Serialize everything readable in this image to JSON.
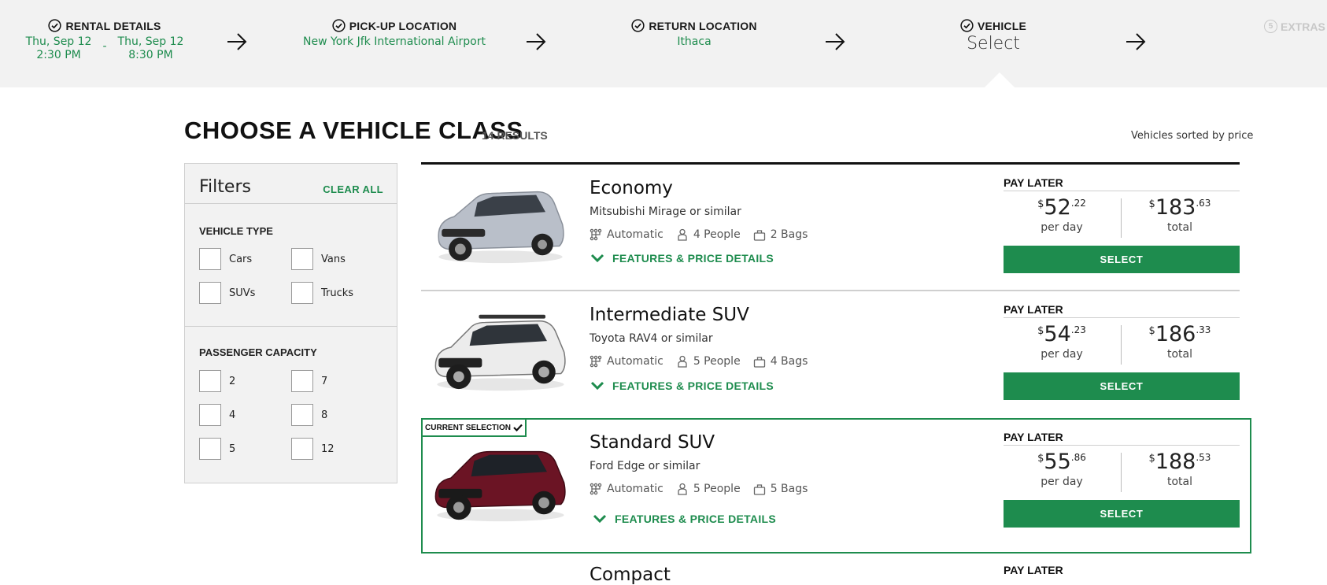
{
  "steps": {
    "rental_details": {
      "label": "RENTAL DETAILS",
      "pickup_date": "Thu, Sep 12",
      "pickup_time": "2:30 PM",
      "dash": "-",
      "return_date": "Thu, Sep 12",
      "return_time": "8:30 PM"
    },
    "pickup_location": {
      "label": "PICK-UP LOCATION",
      "value": "New York Jfk International Airport"
    },
    "return_location": {
      "label": "RETURN LOCATION",
      "value": "Ithaca"
    },
    "vehicle": {
      "label": "VEHICLE",
      "value": "Select"
    },
    "extras": {
      "number": "5",
      "label": "EXTRAS"
    }
  },
  "page": {
    "title": "CHOOSE A VEHICLE CLASS",
    "results": "14 RESULTS",
    "sorted": "Vehicles sorted by price"
  },
  "filters": {
    "title": "Filters",
    "clear_all": "CLEAR ALL",
    "vehicle_type": {
      "title": "VEHICLE TYPE",
      "options": [
        "Cars",
        "Vans",
        "SUVs",
        "Trucks"
      ]
    },
    "passenger_capacity": {
      "title": "PASSENGER CAPACITY",
      "options": [
        "2",
        "7",
        "4",
        "8",
        "5",
        "12"
      ]
    }
  },
  "vehicles": [
    {
      "name": "Economy",
      "model": "Mitsubishi Mirage or similar",
      "transmission": "Automatic",
      "people": "4 People",
      "bags": "2 Bags",
      "features": "FEATURES & PRICE DETAILS",
      "pay_label": "PAY LATER",
      "currency": "$",
      "day_whole": "52",
      "day_cents": ".22",
      "day_label": "per day",
      "total_whole": "183",
      "total_cents": ".63",
      "total_label": "total",
      "select": "SELECT",
      "color": "#b9bfc9"
    },
    {
      "name": "Intermediate SUV",
      "model": "Toyota RAV4 or similar",
      "transmission": "Automatic",
      "people": "5 People",
      "bags": "4 Bags",
      "features": "FEATURES & PRICE DETAILS",
      "pay_label": "PAY LATER",
      "currency": "$",
      "day_whole": "54",
      "day_cents": ".23",
      "day_label": "per day",
      "total_whole": "186",
      "total_cents": ".33",
      "total_label": "total",
      "select": "SELECT",
      "color": "#e9e9e9"
    },
    {
      "name": "Standard SUV",
      "model": "Ford Edge or similar",
      "transmission": "Automatic",
      "people": "5 People",
      "bags": "5 Bags",
      "features": "FEATURES & PRICE DETAILS",
      "pay_label": "PAY LATER",
      "currency": "$",
      "day_whole": "55",
      "day_cents": ".86",
      "day_label": "per day",
      "total_whole": "188",
      "total_cents": ".53",
      "total_label": "total",
      "select": "SELECT",
      "color": "#6b1424",
      "current_selection": "CURRENT SELECTION"
    },
    {
      "name": "Compact",
      "pay_label": "PAY LATER"
    }
  ],
  "colors": {
    "accent": "#1e8c4e",
    "bar": "#f2f2f2"
  }
}
